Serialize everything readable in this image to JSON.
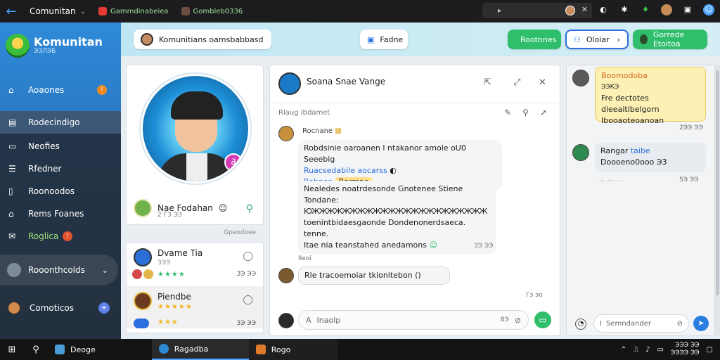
{
  "window": {
    "title": "Comunitan",
    "tabs": [
      "Gammdinabeiea",
      "Gombleb0336"
    ]
  },
  "sidebar": {
    "brand_title": "Komunitan",
    "brand_sub": "ЭЗЛЭБ",
    "items": [
      {
        "label": "Aoaones",
        "badge": "!"
      },
      {
        "label": "Rodecindigo"
      },
      {
        "label": "Neofies"
      },
      {
        "label": "Rfedner"
      },
      {
        "label": "Roonoodos"
      },
      {
        "label": "Rems Foanes"
      },
      {
        "label": "Roglica",
        "badge": "!"
      }
    ],
    "group_label": "Rooonthcolds",
    "comp_label": "Comoticos"
  },
  "header": {
    "community_label": "Komunitians oamsbabbasd",
    "center_label": "Fadne",
    "btn1": "Rootnnes",
    "btn2": "Oloiar",
    "btn3": "Gorrede Etoitoa"
  },
  "profile": {
    "name": "Nae Fodahan",
    "sub": "2 ГЗ ЭЗ",
    "footer": "Gpeodoee"
  },
  "contacts": [
    {
      "name": "Dvame Tia",
      "sub": "3ЭЭ",
      "stars": "★★★★",
      "time": "ЗЭ ЭЭ"
    },
    {
      "name": "Piendbe",
      "sub": "",
      "stars": "★★★★★",
      "time": ""
    },
    {
      "name": "",
      "sub": "",
      "stars": "★★★",
      "time": "3Э ЭЭ"
    }
  ],
  "chat": {
    "title": "Soana Snae Vange",
    "sublabel": "Rlaug Ibdamet",
    "msg1_name": "Rocnane",
    "msg1_line1": "Robdsinie oaroanen l ntakanor amole oU0 Seeebig",
    "msg1_link": "Ruacsedabile aocarss",
    "msg1_tag": "Rohnos",
    "msg1_hl": "Rarmae",
    "msg2_line1": "Nealedes noatrdesonde Gnotenee Stiene Tondane:",
    "msg2_line2": "ЮЖЖЖЖЖЖЖЖЖЖЖЖЖЖЖЖЖЖЖЖЖЖЖ",
    "msg2_line3": "toenintbidaesgaonde Dondenonerdsaeca. tenne.",
    "msg2_line4": "Itae nia teanstahed anedamons",
    "msg2_time": "3Э ЭЭ",
    "msg3_label": "Ileoi",
    "msg3_text": "Rle tracoemoiar tkionitebon",
    "msg3_time": "Гэ эо",
    "input_placeholder": "Inaolp",
    "input_count": "8Э"
  },
  "right": {
    "msg1_title": "Boomodoba",
    "msg1_l1": "ЭЭКЭ",
    "msg1_l2": "Fre dectotes dieeaitibelgorn",
    "msg1_l3": "Ibooaoteoanoan",
    "msg1_time": "2ЭЭ ЭЭ",
    "msg2_name": "Rangar",
    "msg2_tag": "taibe",
    "msg2_text": "Doooeno0ooo Э3",
    "msg2_time": "5Э ЭЭ",
    "input_placeholder": "Semndander"
  },
  "taskbar": {
    "items": [
      "Deoge",
      "Ragadba",
      "Rogo"
    ],
    "clock_time": "ЭЭЭ ЭЭ",
    "clock_date": "ЭЭЭЭ ЭЭ"
  }
}
